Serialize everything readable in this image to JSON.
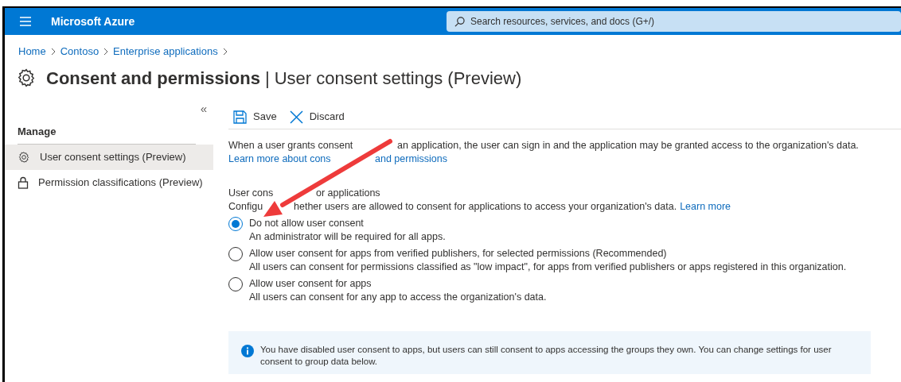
{
  "topbar": {
    "brand": "Microsoft Azure",
    "search": {
      "placeholder": "Search resources, services, and docs (G+/)"
    }
  },
  "breadcrumb": [
    "Home",
    "Contoso",
    "Enterprise applications"
  ],
  "title": {
    "main": "Consent and permissions",
    "separator": "|",
    "sub": "User consent settings (Preview)"
  },
  "sidebar": {
    "collapse": "«",
    "section": "Manage",
    "items": [
      {
        "label": "User consent settings (Preview)",
        "selected": true
      },
      {
        "label": "Permission classifications (Preview)",
        "selected": false
      }
    ]
  },
  "toolbar": [
    {
      "label": "Save"
    },
    {
      "label": "Discard"
    }
  ],
  "intro": {
    "text_parts": [
      "When a user grants consent",
      "an application, the user can sign in and the application may be granted access to the organization's data."
    ],
    "link_parts": [
      "Learn more about cons",
      "and permissions"
    ]
  },
  "consent": {
    "heading_parts": [
      "User cons",
      "or applications"
    ],
    "description_parts": [
      "Configu",
      "hether users are allowed to consent for applications to access your organization's data."
    ],
    "link": "Learn more",
    "options": [
      {
        "label": "Do not allow user consent",
        "detail": "An administrator will be required for all apps.",
        "selected": true
      },
      {
        "label": "Allow user consent for apps from verified publishers, for selected permissions (Recommended)",
        "detail": "All users can consent for permissions classified as \"low impact\", for apps from verified publishers or apps registered in this organization.",
        "selected": false
      },
      {
        "label": "Allow user consent for apps",
        "detail": "All users can consent for any app to access the organization's data.",
        "selected": false
      }
    ]
  },
  "info": {
    "text": "You have disabled user consent to apps, but users can still consent to apps accessing the groups they own. You can change settings for user consent to group data below."
  }
}
